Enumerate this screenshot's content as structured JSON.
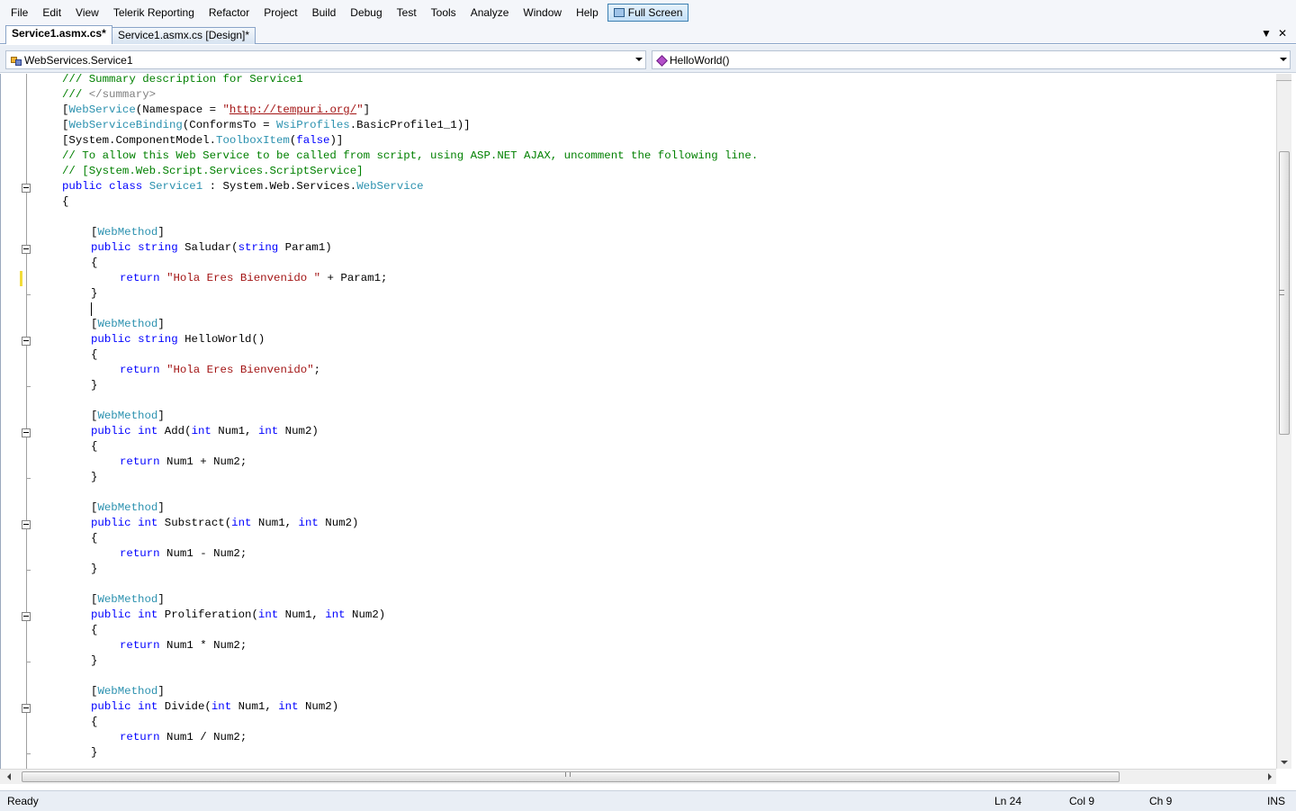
{
  "menu": {
    "items": [
      "File",
      "Edit",
      "View",
      "Telerik Reporting",
      "Refactor",
      "Project",
      "Build",
      "Debug",
      "Test",
      "Tools",
      "Analyze",
      "Window",
      "Help"
    ],
    "fullscreen_label": "Full Screen"
  },
  "tabs": {
    "active": "Service1.asmx.cs*",
    "inactive": "Service1.asmx.cs [Design]*",
    "dropdown_glyph": "▼",
    "close_glyph": "✕"
  },
  "nav": {
    "type_dropdown": "WebServices.Service1",
    "member_dropdown": "HelloWorld()"
  },
  "code": {
    "summary_comment": "/// Summary description for Service1",
    "summary_close_a": "/// ",
    "summary_close_b": "</summary>",
    "ws_open": "[",
    "ws_attr": "WebService",
    "ws_args": "(Namespace = ",
    "ws_quote": "\"",
    "ws_url": "http://tempuri.org/",
    "ws_end": "\")]",
    "wsb_attr": "WebServiceBinding",
    "wsb_args_a": "(ConformsTo = ",
    "wsb_type": "WsiProfiles",
    "wsb_args_b": ".BasicProfile1_1)]",
    "tb_a": "[System.ComponentModel.",
    "tb_type": "ToolboxItem",
    "tb_b": "(",
    "tb_false": "false",
    "tb_c": ")]",
    "ajax_comment": "// To allow this Web Service to be called from script, using ASP.NET AJAX, uncomment the following line.",
    "script_comment": "// [System.Web.Script.Services.ScriptService]",
    "kw_public": "public",
    "kw_class": "class",
    "kw_string": "string",
    "kw_int": "int",
    "kw_return": "return",
    "class_name": "Service1",
    "class_base_a": " : System.Web.Services.",
    "class_base_type": "WebService",
    "open_brace": "{",
    "close_brace": "}",
    "bracket_open": "[",
    "bracket_close": "]",
    "webmethod": "WebMethod",
    "saludar_sig_a": " Saludar(",
    "saludar_sig_b": " Param1)",
    "saludar_str": "\"Hola Eres Bienvenido \"",
    "saludar_rest": " + Param1;",
    "hello_sig": " HelloWorld()",
    "hello_str": "\"Hola Eres Bienvenido\"",
    "semicolon": ";",
    "add_sig_a": " Add(",
    "sub_sig_a": " Substract(",
    "pro_sig_a": " Proliferation(",
    "div_sig_a": " Divide(",
    "num1_comma": " Num1, ",
    "num2_close": " Num2)",
    "ret_add": " Num1 + Num2;",
    "ret_sub": " Num1 - Num2;",
    "ret_pro": " Num1 * Num2;",
    "ret_div": " Num1 / Num2;"
  },
  "status": {
    "message": "Ready",
    "line": "Ln 24",
    "col": "Col 9",
    "ch": "Ch 9",
    "mode": "INS"
  }
}
